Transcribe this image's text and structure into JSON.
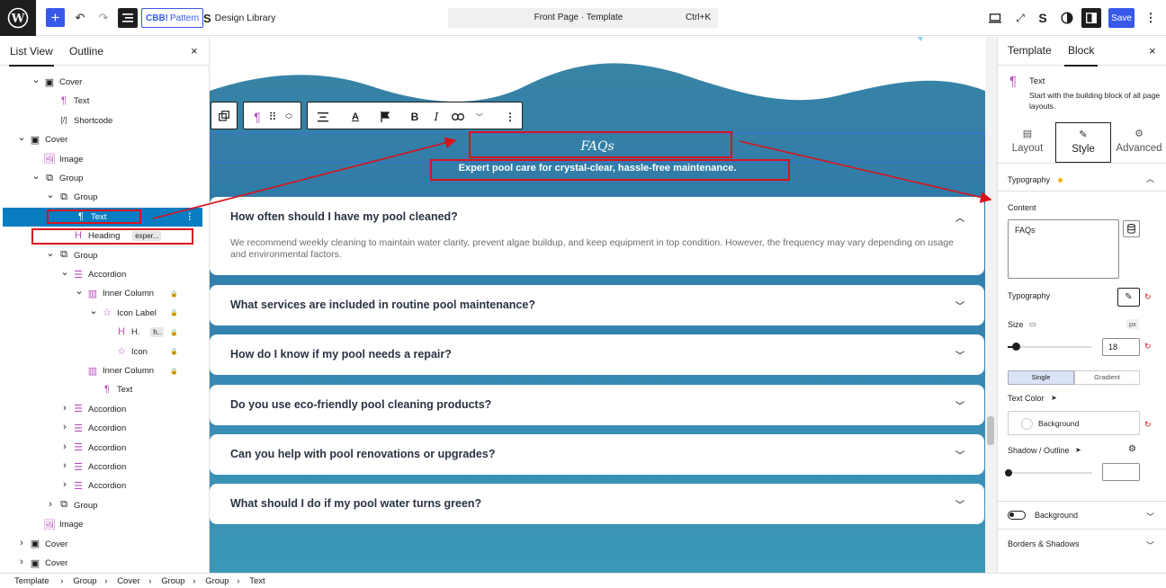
{
  "topbar": {
    "pattern_prefix": "CBB!",
    "pattern_label": "Pattern",
    "design_library_label": "Design Library",
    "command_title": "Front Page · Template",
    "command_shortcut": "Ctrl+K",
    "save_label": "Save"
  },
  "left_panel": {
    "tab_list": "List View",
    "tab_outline": "Outline",
    "close": "×",
    "rows": [
      {
        "label": "Cover",
        "depth": 1
      },
      {
        "label": "Text",
        "depth": 2
      },
      {
        "label": "Shortcode",
        "depth": 2
      },
      {
        "label": "Cover",
        "depth": 0
      },
      {
        "label": "Image",
        "depth": 1
      },
      {
        "label": "Group",
        "depth": 1
      },
      {
        "label": "Group",
        "depth": 2
      },
      {
        "label": "Text",
        "depth": 3,
        "selected": true
      },
      {
        "label": "Heading",
        "depth": 3,
        "badge": "exper..."
      },
      {
        "label": "Group",
        "depth": 2
      },
      {
        "label": "Accordion",
        "depth": 3
      },
      {
        "label": "Inner Column",
        "depth": 4
      },
      {
        "label": "Icon Label",
        "depth": 5
      },
      {
        "label": "H.",
        "depth": 6,
        "badge": "h.."
      },
      {
        "label": "Icon",
        "depth": 6
      },
      {
        "label": "Inner Column",
        "depth": 4
      },
      {
        "label": "Text",
        "depth": 5
      },
      {
        "label": "Accordion",
        "depth": 3
      },
      {
        "label": "Accordion",
        "depth": 3
      },
      {
        "label": "Accordion",
        "depth": 3
      },
      {
        "label": "Accordion",
        "depth": 3
      },
      {
        "label": "Accordion",
        "depth": 3
      },
      {
        "label": "Group",
        "depth": 2
      },
      {
        "label": "Image",
        "depth": 1
      },
      {
        "label": "Cover",
        "depth": 0
      },
      {
        "label": "Cover",
        "depth": 0
      }
    ]
  },
  "canvas": {
    "faq_title": "FAQs",
    "faq_subtitle": "Expert pool care for crystal-clear, hassle-free maintenance.",
    "faqs": [
      {
        "q": "How often should I have my pool cleaned?",
        "a": "We recommend weekly cleaning to maintain water clarity, prevent algae buildup, and keep equipment in top condition. However, the frequency may vary depending on usage and environmental factors.",
        "open": true
      },
      {
        "q": "What services are included in routine pool maintenance?"
      },
      {
        "q": "How do I know if my pool needs a repair?"
      },
      {
        "q": "Do you use eco-friendly pool cleaning products?"
      },
      {
        "q": "Can you help with pool renovations or upgrades?"
      },
      {
        "q": "What should I do if my pool water turns green?"
      }
    ]
  },
  "right_panel": {
    "tab_template": "Template",
    "tab_block": "Block",
    "block_name": "Text",
    "block_desc": "Start with the building block of all page layouts.",
    "sub_layout": "Layout",
    "sub_style": "Style",
    "sub_advanced": "Advanced",
    "typography_section": "Typography",
    "content_label": "Content",
    "content_value": "FAQs",
    "typography_label": "Typography",
    "size_label": "Size",
    "size_unit": "px",
    "size_value": "18",
    "size_fraction": 0.1,
    "single_label": "Single",
    "gradient_label": "Gradient",
    "text_color_label": "Text Color",
    "background_label": "Background",
    "shadow_label": "Shadow / Outline",
    "background_section": "Background",
    "borders_section": "Borders & Shadows"
  },
  "footer": {
    "breadcrumbs": [
      "Template",
      "Group",
      "Cover",
      "Group",
      "Group",
      "Text"
    ]
  },
  "colors": {
    "accent": "#3858e9",
    "selection": "#0a7cc1",
    "annotation_red": "#d9121b"
  }
}
